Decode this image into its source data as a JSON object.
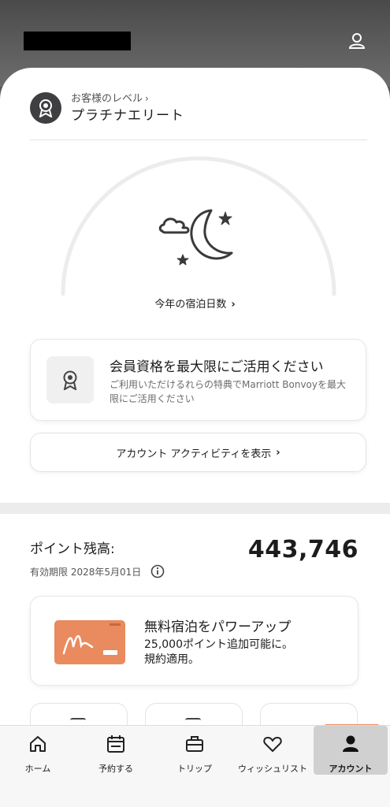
{
  "header": {
    "user_icon": "user-icon"
  },
  "member_level": {
    "caption": "お客様のレベル",
    "chevron": "›",
    "name": "プラチナエリート",
    "badge_icon": "award-ribbon-icon"
  },
  "nights": {
    "icon": "moon-clouds-stars-icon",
    "label": "今年の宿泊日数",
    "chevron": "›"
  },
  "benefits_card": {
    "icon": "award-ribbon-icon",
    "title": "会員資格を最大限にご活用ください",
    "description": "ご利用いただけるれらの特典でMarriott Bonvoyを最大限にご活用ください"
  },
  "activity_button": {
    "label": "アカウント アクティビティを表示",
    "chevron": "›"
  },
  "points": {
    "label": "ポイント残高:",
    "value": "443,746",
    "expiry": "有効期限 2028年5月01日",
    "info_icon": "info-icon"
  },
  "promo_card": {
    "title": "無料宿泊をパワーアップ",
    "line1": "25,000ポイント追加可能に。",
    "line2": "規約適用。",
    "art_color": "#e98a5f"
  },
  "bottom_nav": {
    "items": [
      {
        "label": "ホーム",
        "icon": "home-icon",
        "active": false
      },
      {
        "label": "予約する",
        "icon": "calendar-icon",
        "active": false
      },
      {
        "label": "トリップ",
        "icon": "suitcase-icon",
        "active": false
      },
      {
        "label": "ウィッシュリスト",
        "icon": "heart-icon",
        "active": false
      },
      {
        "label": "アカウント",
        "icon": "account-icon",
        "active": true
      }
    ]
  },
  "colors": {
    "accent": "#e98a5f",
    "badge_dark": "#3f3f41",
    "header_bg": "#5a5a5a"
  }
}
